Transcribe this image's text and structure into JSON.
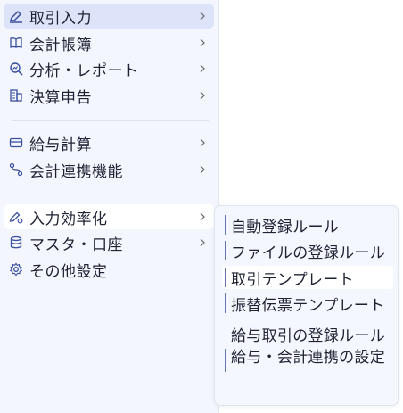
{
  "sidebar": {
    "items": [
      {
        "label": "取引入力",
        "icon": "pen-icon",
        "state": "active"
      },
      {
        "label": "会計帳簿",
        "icon": "book-icon"
      },
      {
        "label": "分析・レポート",
        "icon": "magnify-chart-icon"
      },
      {
        "label": "決算申告",
        "icon": "building-icon"
      },
      {
        "label": "給与計算",
        "icon": "card-icon"
      },
      {
        "label": "会計連携機能",
        "icon": "link-route-icon"
      },
      {
        "label": "入力効率化",
        "icon": "pen-gear-icon",
        "state": "hover"
      },
      {
        "label": "マスタ・口座",
        "icon": "database-icon"
      },
      {
        "label": "その他設定",
        "icon": "gear-icon"
      }
    ]
  },
  "submenu": {
    "parent": "入力効率化",
    "items": [
      {
        "label": "自動登録ルール",
        "bar": true
      },
      {
        "label": "ファイルの登録ルール",
        "bar": true
      },
      {
        "label": "取引テンプレート",
        "bar": true,
        "state": "hover"
      },
      {
        "label": "振替伝票テンプレート",
        "bar": true
      },
      {
        "label": "給与取引の登録ルール",
        "bar": false
      },
      {
        "label": "給与・会計連携の設定",
        "bar": true
      }
    ]
  },
  "colors": {
    "sidebar_bg": "#f3f6fc",
    "active_bg": "#dde4fa",
    "accent": "#3b4fa0",
    "text": "#1e2233"
  }
}
